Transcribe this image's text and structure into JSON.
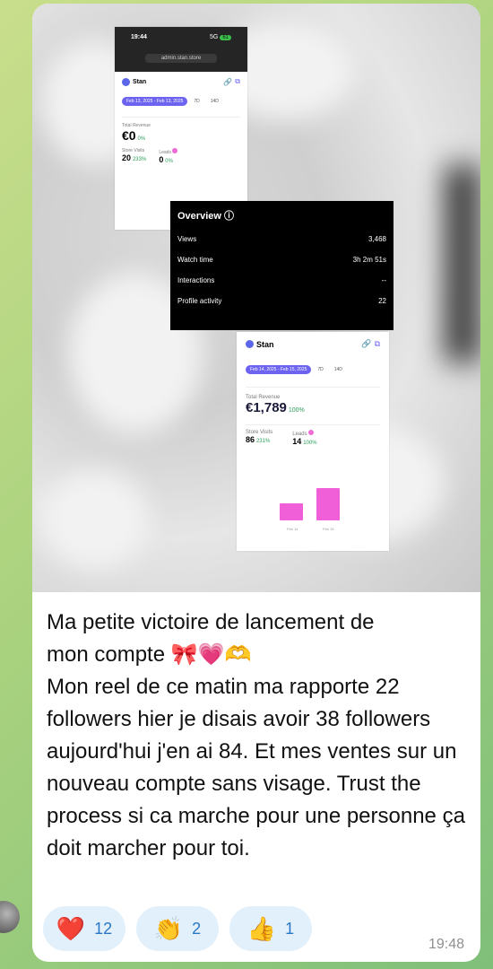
{
  "phone_card": {
    "time": "19:44",
    "signal": "5G",
    "battery": "61",
    "url": "admin.stan.store",
    "brand": "Stan",
    "date_range": "Feb 13, 2025 - Feb 13, 2025",
    "tab_7d": "7D",
    "tab_14d": "14D",
    "revenue_label": "Total Revenue",
    "revenue_value": "€0",
    "revenue_change": "0%",
    "visits_label": "Store Visits",
    "visits_value": "20",
    "visits_change": "233%",
    "leads_label": "Leads",
    "leads_value": "0",
    "leads_change": "0%"
  },
  "overview": {
    "title": "Overview",
    "rows": [
      {
        "label": "Views",
        "value": "3,468"
      },
      {
        "label": "Watch time",
        "value": "3h 2m 51s"
      },
      {
        "label": "Interactions",
        "value": "--"
      },
      {
        "label": "Profile activity",
        "value": "22"
      }
    ]
  },
  "stan_card": {
    "brand": "Stan",
    "date_range": "Feb 14, 2025 - Feb 15, 2025",
    "tab_7d": "7D",
    "tab_14d": "14D",
    "revenue_label": "Total Revenue",
    "revenue_value": "€1,789",
    "revenue_change": "100%",
    "visits_label": "Store Visits",
    "visits_value": "86",
    "visits_change": "231%",
    "leads_label": "Leads",
    "leads_value": "14",
    "leads_change": "100%",
    "chart_labels": [
      "Feb 14",
      "Feb 15"
    ],
    "chart_bars_relative": [
      0.5,
      1.0
    ],
    "bar_color": "#f05fd8"
  },
  "message": {
    "line1": "Ma petite victoire de lancement  de",
    "line2": "mon compte 🎀💗🫶",
    "body": "Mon reel de ce matin ma rapporte 22 followers hier je disais avoir 38 followers aujourd'hui j'en ai  84. Et mes ventes sur un nouveau compte sans visage. Trust the process  si ca marche pour une personne ça  doit marcher pour toi."
  },
  "reactions": [
    {
      "emoji": "❤️",
      "count": "12",
      "icon": "heart-icon"
    },
    {
      "emoji": "👏",
      "count": "2",
      "icon": "clap-icon"
    },
    {
      "emoji": "👍",
      "count": "1",
      "icon": "thumbs-up-icon"
    }
  ],
  "timestamp": "19:48"
}
